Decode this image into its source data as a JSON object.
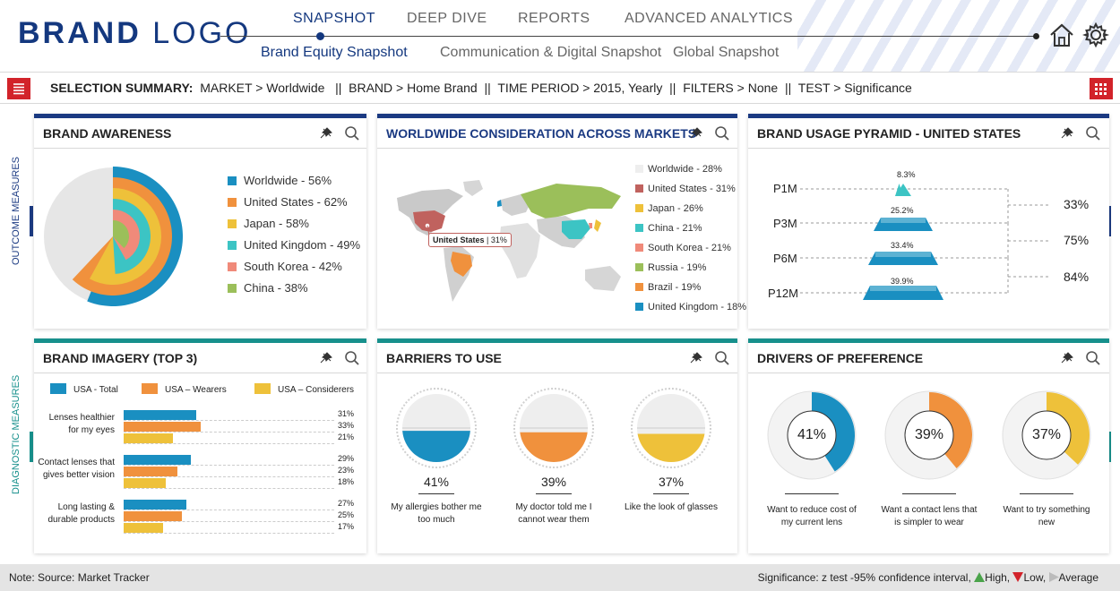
{
  "header": {
    "logo_bold": "BRAND",
    "logo_light": "LOGO",
    "nav_top": [
      "SNAPSHOT",
      "DEEP DIVE",
      "REPORTS",
      "ADVANCED ANALYTICS"
    ],
    "nav_sub": [
      "Brand Equity Snapshot",
      "Communication & Digital Snapshot",
      "Global Snapshot"
    ],
    "home_icon": "home-icon",
    "settings_icon": "gear-icon"
  },
  "selection": {
    "label": "SELECTION SUMMARY:",
    "market_key": "MARKET",
    "market_val": "Worldwide",
    "brand_key": "BRAND",
    "brand_val": "Home Brand",
    "period_key": "TIME PERIOD",
    "period_val": "2015, Yearly",
    "filters_key": "FILTERS",
    "filters_val": "None",
    "test_key": "TEST",
    "test_val": "Significance"
  },
  "side": {
    "outcome": "OUTCOME MEASURES",
    "diagnostic": "DIAGNOSTIC MEASURES"
  },
  "panels": {
    "awareness": {
      "title": "BRAND AWARENESS",
      "legend": [
        "Worldwide - 56%",
        "United States - 62%",
        "Japan - 58%",
        "United Kingdom - 49%",
        "South Korea - 42%",
        "China - 38%"
      ],
      "colors": [
        "#1a8fc1",
        "#f0913d",
        "#eec13a",
        "#3cc4c4",
        "#f08a7a",
        "#9bbf5a"
      ]
    },
    "consideration": {
      "title": "WORLDWIDE CONSIDERATION ACROSS MARKETS",
      "tooltip_country": "United States",
      "tooltip_value": "31%",
      "legend": [
        "Worldwide - 28%",
        "United States - 31%",
        "Japan - 26%",
        "China - 21%",
        "South Korea - 21%",
        "Russia - 19%",
        "Brazil - 19%",
        "United Kingdom - 18%"
      ],
      "colors": [
        "#eeeeee",
        "#c0625e",
        "#eec13a",
        "#3cc4c4",
        "#f08a7a",
        "#9bbf5a",
        "#f0913d",
        "#1a8fc1"
      ]
    },
    "pyramid": {
      "title": "BRAND USAGE PYRAMID - UNITED STATES",
      "levels": [
        "P1M",
        "P3M",
        "P6M",
        "P12M"
      ],
      "values": [
        "8.3%",
        "25.2%",
        "33.4%",
        "39.9%"
      ],
      "conversions": [
        "33%",
        "75%",
        "84%"
      ]
    },
    "imagery": {
      "title": "BRAND IMAGERY (TOP 3)",
      "legend": [
        "USA - Total",
        "USA – Wearers",
        "USA – Considerers"
      ],
      "items": [
        {
          "label1": "Lenses healthier",
          "label2": "for my eyes",
          "values": [
            "31%",
            "33%",
            "21%"
          ]
        },
        {
          "label1": "Contact lenses that",
          "label2": "gives better vision",
          "values": [
            "29%",
            "23%",
            "18%"
          ]
        },
        {
          "label1": "Long lasting &",
          "label2": "durable products",
          "values": [
            "27%",
            "25%",
            "17%"
          ]
        }
      ]
    },
    "barriers": {
      "title": "BARRIERS TO USE",
      "items": [
        {
          "value": "41%",
          "label1": "My allergies bother me",
          "label2": "too much"
        },
        {
          "value": "39%",
          "label1": "My doctor told me I",
          "label2": "cannot wear them"
        },
        {
          "value": "37%",
          "label1": "Like the look of glasses",
          "label2": ""
        }
      ]
    },
    "drivers": {
      "title": "DRIVERS OF PREFERENCE",
      "items": [
        {
          "value": "41%",
          "label1": "Want to reduce cost of",
          "label2": "my current lens"
        },
        {
          "value": "39%",
          "label1": "Want a contact lens that",
          "label2": "is simpler to wear"
        },
        {
          "value": "37%",
          "label1": "Want to try something",
          "label2": "new"
        }
      ]
    }
  },
  "chart_data": [
    {
      "type": "pie",
      "title": "BRAND AWARENESS",
      "categories": [
        "Worldwide",
        "United States",
        "Japan",
        "United Kingdom",
        "South Korea",
        "China"
      ],
      "values": [
        56,
        62,
        58,
        49,
        42,
        38
      ]
    },
    {
      "type": "bar",
      "title": "BRAND USAGE PYRAMID - UNITED STATES",
      "categories": [
        "P1M",
        "P3M",
        "P6M",
        "P12M"
      ],
      "values": [
        8.3,
        25.2,
        33.4,
        39.9
      ]
    },
    {
      "type": "bar",
      "title": "BRAND IMAGERY (TOP 3)",
      "categories": [
        "Lenses healthier for my eyes",
        "Contact lenses that gives better vision",
        "Long lasting & durable products"
      ],
      "series": [
        {
          "name": "USA - Total",
          "values": [
            31,
            29,
            27
          ]
        },
        {
          "name": "USA – Wearers",
          "values": [
            33,
            23,
            25
          ]
        },
        {
          "name": "USA – Considerers",
          "values": [
            21,
            18,
            17
          ]
        }
      ]
    },
    {
      "type": "bar",
      "title": "BARRIERS TO USE",
      "categories": [
        "My allergies bother me too much",
        "My doctor told me I cannot wear them",
        "Like the look of glasses"
      ],
      "values": [
        41,
        39,
        37
      ]
    },
    {
      "type": "pie",
      "title": "DRIVERS OF PREFERENCE",
      "categories": [
        "Want to reduce cost of my current lens",
        "Want a contact lens that is simpler to wear",
        "Want to try something new"
      ],
      "values": [
        41,
        39,
        37
      ]
    }
  ],
  "footer": {
    "note": "Note: Source: Market Tracker",
    "significance": "Significance: z test -95% confidence interval,",
    "high": "High,",
    "low": "Low,",
    "average": "Average"
  }
}
